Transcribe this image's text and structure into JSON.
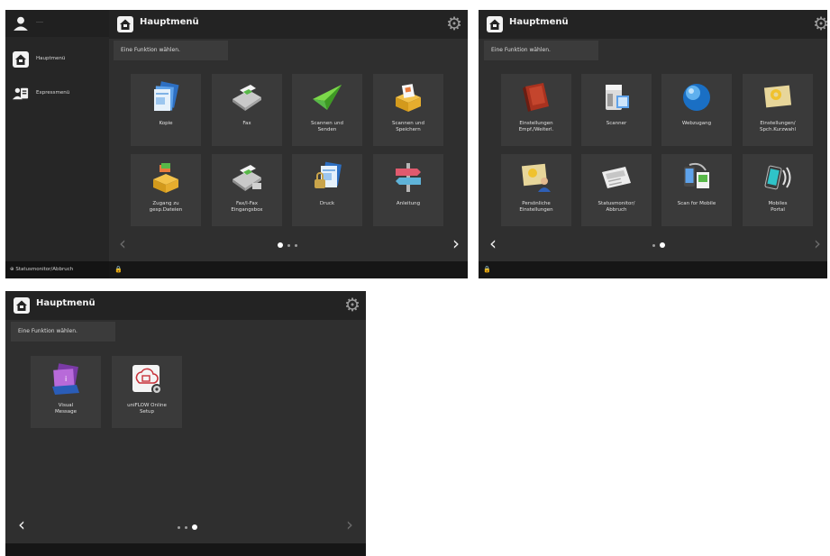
{
  "panel1": {
    "title": "Hauptmenü",
    "prompt": "Eine Funktion wählen.",
    "sidebar": {
      "user_label": "----",
      "items": [
        {
          "label": "Hauptmenü",
          "icon": "home-icon"
        },
        {
          "label": "Expressmenü",
          "icon": "express-menu-icon"
        }
      ],
      "status_monitor_label": "Statusmonitor/Abbruch"
    },
    "tiles": [
      {
        "label": "Kopie",
        "icon": "copy-icon"
      },
      {
        "label": "Fax",
        "icon": "fax-icon"
      },
      {
        "label": "Scannen und\nSenden",
        "icon": "scan-send-icon"
      },
      {
        "label": "Scannen und\nSpeichern",
        "icon": "scan-store-icon"
      },
      {
        "label": "Zugang zu\ngesp.Dateien",
        "icon": "stored-files-icon"
      },
      {
        "label": "Fax/I-Fax\nEingangsbox",
        "icon": "fax-inbox-icon"
      },
      {
        "label": "Druck",
        "icon": "print-icon"
      },
      {
        "label": "Anleitung",
        "icon": "guide-icon"
      }
    ],
    "page_indicator": {
      "current": 1,
      "total": 3
    },
    "footer_lock": "🔒"
  },
  "panel2": {
    "title": "Hauptmenü",
    "prompt": "Eine Funktion wählen.",
    "tiles": [
      {
        "label": "Einstellungen\nEmpf./Weiterl.",
        "icon": "rx-forward-settings-icon"
      },
      {
        "label": "Scanner",
        "icon": "scanner-icon"
      },
      {
        "label": "Webzugang",
        "icon": "web-access-icon"
      },
      {
        "label": "Einstellungen/\nSpch.Kurzwahl",
        "icon": "favorite-settings-icon"
      },
      {
        "label": "Persönliche\nEinstellungen",
        "icon": "personal-settings-icon"
      },
      {
        "label": "Statusmonitor/\nAbbruch",
        "icon": "status-monitor-icon"
      },
      {
        "label": "Scan for Mobile",
        "icon": "scan-for-mobile-icon"
      },
      {
        "label": "Mobiles\nPortal",
        "icon": "mobile-portal-icon"
      }
    ],
    "page_indicator": {
      "current": 2,
      "total": 2
    },
    "footer_lock": "🔒"
  },
  "panel3": {
    "title": "Hauptmenü",
    "prompt": "Eine Funktion wählen.",
    "tiles": [
      {
        "label": "Visual\nMessage",
        "icon": "visual-message-icon"
      },
      {
        "label": "uniFLOW Online\nSetup",
        "icon": "uniflow-setup-icon"
      }
    ],
    "page_indicator": {
      "current": 3,
      "total": 3
    }
  },
  "colors": {
    "screen_bg": "#2f2f2f",
    "tile_bg": "#3a3a3a",
    "bar_bg": "#232323",
    "footer_bg": "#161616"
  }
}
